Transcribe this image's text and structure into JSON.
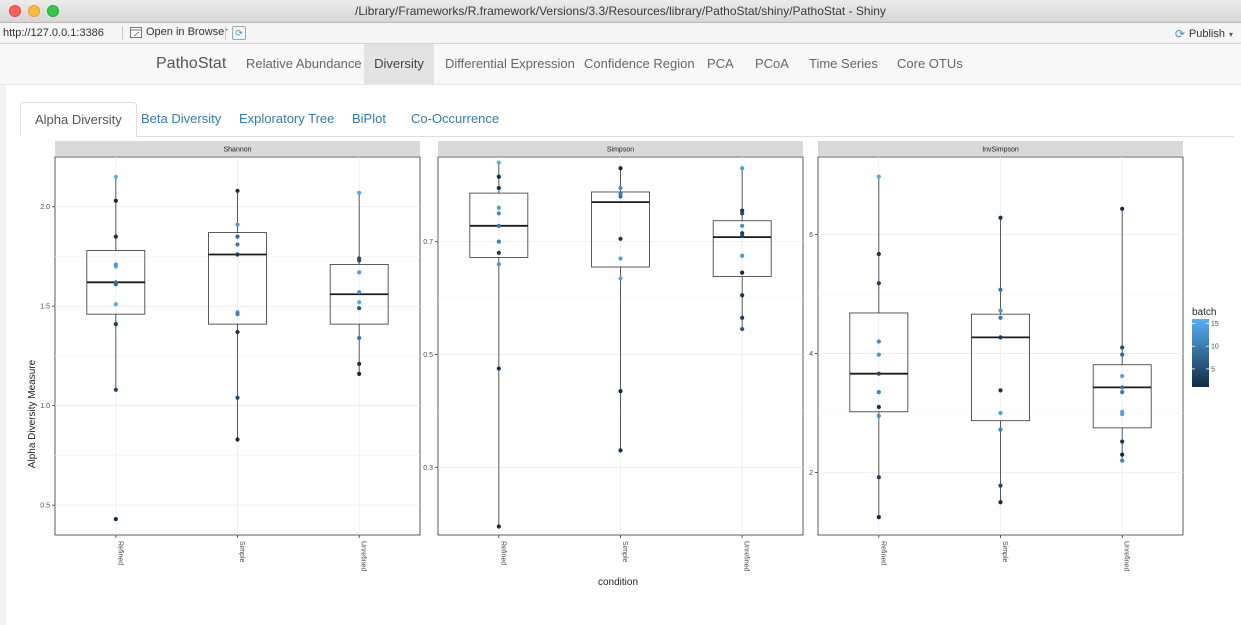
{
  "window": {
    "title": "/Library/Frameworks/R.framework/Versions/3.3/Resources/library/PathoStat/shiny/PathoStat - Shiny"
  },
  "urlbar": {
    "url": "http://127.0.0.1:3386",
    "open_browser": "Open in Browser",
    "publish": "Publish"
  },
  "navbar": {
    "brand": "PathoStat",
    "items": [
      "Relative Abundance",
      "Diversity",
      "Differential Expression",
      "Confidence Region",
      "PCA",
      "PCoA",
      "Time Series",
      "Core OTUs"
    ],
    "active": "Diversity"
  },
  "tabs": {
    "items": [
      "Alpha Diversity",
      "Beta Diversity",
      "Exploratory Tree",
      "BiPlot",
      "Co-Occurrence"
    ],
    "active": "Alpha Diversity"
  },
  "colors": {
    "low": "#132B43",
    "high": "#56B1F7"
  },
  "chart_data": {
    "type": "box",
    "xlabel": "condition",
    "ylabel": "Alpha Diversity Measure",
    "categories": [
      "Refined",
      "Simple",
      "Unrefined"
    ],
    "legend": {
      "title": "batch",
      "ticks": [
        5,
        10,
        15
      ],
      "range": [
        1,
        16
      ],
      "placement": "right"
    },
    "panels": [
      {
        "name": "Shannon",
        "ylim": [
          0.35,
          2.25
        ],
        "yticks": [
          0.5,
          1.0,
          1.5,
          2.0
        ],
        "ytick_labels": [
          "0.5",
          "1.0",
          "1.5",
          "2.0"
        ],
        "boxes": [
          {
            "q1": 1.46,
            "median": 1.62,
            "q3": 1.78,
            "lo": 1.08,
            "hi": 2.15
          },
          {
            "q1": 1.41,
            "median": 1.76,
            "q3": 1.87,
            "lo": 0.82,
            "hi": 2.08
          },
          {
            "q1": 1.41,
            "median": 1.56,
            "q3": 1.71,
            "lo": 1.15,
            "hi": 2.07
          }
        ],
        "points": [
          [
            [
              2.15,
              16
            ],
            [
              2.03,
              1
            ],
            [
              1.85,
              2
            ],
            [
              1.71,
              13
            ],
            [
              1.7,
              14
            ],
            [
              1.62,
              9
            ],
            [
              1.61,
              8
            ],
            [
              1.51,
              15
            ],
            [
              1.41,
              3
            ],
            [
              1.08,
              4
            ],
            [
              0.43,
              1
            ]
          ],
          [
            [
              2.08,
              1
            ],
            [
              1.91,
              14
            ],
            [
              1.85,
              8
            ],
            [
              1.81,
              10
            ],
            [
              1.76,
              3
            ],
            [
              1.47,
              13
            ],
            [
              1.46,
              11
            ],
            [
              1.37,
              2
            ],
            [
              1.04,
              5
            ],
            [
              0.83,
              1
            ]
          ],
          [
            [
              2.07,
              15
            ],
            [
              1.74,
              4
            ],
            [
              1.73,
              5
            ],
            [
              1.67,
              14
            ],
            [
              1.57,
              12
            ],
            [
              1.52,
              15
            ],
            [
              1.49,
              6
            ],
            [
              1.34,
              9
            ],
            [
              1.21,
              2
            ],
            [
              1.16,
              1
            ]
          ]
        ]
      },
      {
        "name": "Simpson",
        "ylim": [
          0.18,
          0.85
        ],
        "yticks": [
          0.3,
          0.5,
          0.7
        ],
        "ytick_labels": [
          "0.3",
          "0.5",
          "0.7"
        ],
        "boxes": [
          {
            "q1": 0.672,
            "median": 0.728,
            "q3": 0.786,
            "lo": 0.195,
            "hi": 0.84
          },
          {
            "q1": 0.655,
            "median": 0.77,
            "q3": 0.788,
            "lo": 0.33,
            "hi": 0.83
          },
          {
            "q1": 0.638,
            "median": 0.708,
            "q3": 0.737,
            "lo": 0.545,
            "hi": 0.83
          }
        ],
        "points": [
          [
            [
              0.84,
              16
            ],
            [
              0.815,
              1
            ],
            [
              0.795,
              2
            ],
            [
              0.76,
              14
            ],
            [
              0.75,
              12
            ],
            [
              0.728,
              10
            ],
            [
              0.7,
              11
            ],
            [
              0.68,
              3
            ],
            [
              0.66,
              13
            ],
            [
              0.475,
              2
            ],
            [
              0.195,
              1
            ]
          ],
          [
            [
              0.83,
              1
            ],
            [
              0.795,
              12
            ],
            [
              0.785,
              10
            ],
            [
              0.78,
              9
            ],
            [
              0.705,
              2
            ],
            [
              0.67,
              14
            ],
            [
              0.635,
              15
            ],
            [
              0.435,
              1
            ],
            [
              0.33,
              2
            ]
          ],
          [
            [
              0.83,
              14
            ],
            [
              0.755,
              2
            ],
            [
              0.75,
              5
            ],
            [
              0.728,
              12
            ],
            [
              0.715,
              3
            ],
            [
              0.71,
              4
            ],
            [
              0.675,
              13
            ],
            [
              0.645,
              1
            ],
            [
              0.605,
              2
            ],
            [
              0.565,
              3
            ],
            [
              0.545,
              6
            ]
          ]
        ]
      },
      {
        "name": "InvSimpson",
        "ylim": [
          0.95,
          7.3
        ],
        "yticks": [
          2,
          4,
          6
        ],
        "ytick_labels": [
          "2",
          "4",
          "6"
        ],
        "boxes": [
          {
            "q1": 3.02,
            "median": 3.66,
            "q3": 4.68,
            "lo": 1.25,
            "hi": 6.97
          },
          {
            "q1": 2.87,
            "median": 4.27,
            "q3": 4.66,
            "lo": 1.5,
            "hi": 6.28
          },
          {
            "q1": 2.75,
            "median": 3.43,
            "q3": 3.81,
            "lo": 2.2,
            "hi": 6.43
          }
        ],
        "points": [
          [
            [
              6.97,
              15
            ],
            [
              5.67,
              2
            ],
            [
              5.18,
              3
            ],
            [
              4.2,
              12
            ],
            [
              3.98,
              13
            ],
            [
              3.66,
              4
            ],
            [
              3.35,
              11
            ],
            [
              3.1,
              2
            ],
            [
              2.95,
              12
            ],
            [
              1.92,
              3
            ],
            [
              1.25,
              1
            ]
          ],
          [
            [
              6.28,
              2
            ],
            [
              5.07,
              9
            ],
            [
              4.72,
              13
            ],
            [
              4.6,
              10
            ],
            [
              4.27,
              3
            ],
            [
              3.38,
              2
            ],
            [
              3.0,
              14
            ],
            [
              2.72,
              11
            ],
            [
              1.78,
              4
            ],
            [
              1.5,
              1
            ]
          ],
          [
            [
              6.43,
              1
            ],
            [
              4.1,
              5
            ],
            [
              3.98,
              8
            ],
            [
              3.62,
              14
            ],
            [
              3.43,
              9
            ],
            [
              3.35,
              10
            ],
            [
              3.02,
              15
            ],
            [
              2.98,
              14
            ],
            [
              2.52,
              2
            ],
            [
              2.3,
              1
            ],
            [
              2.2,
              11
            ]
          ]
        ]
      }
    ]
  }
}
